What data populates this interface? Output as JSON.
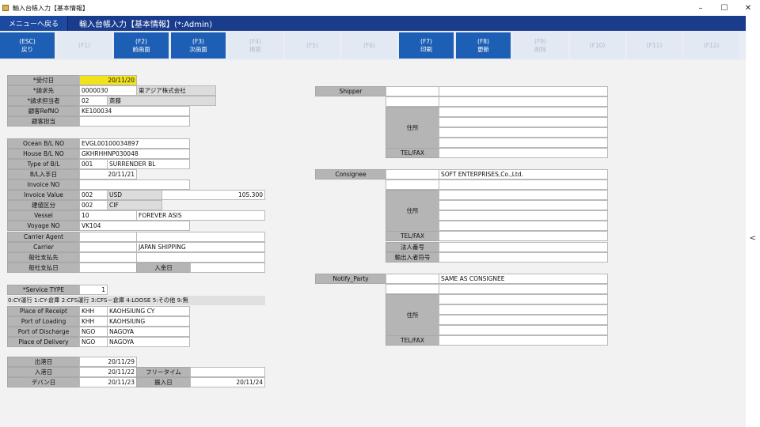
{
  "window": {
    "title": "輸入台帳入力【基本情報】",
    "min": "–",
    "max": "☐",
    "close": "✕"
  },
  "header": {
    "back": "メニューへ戻る",
    "title": "輸入台帳入力【基本情報】(*:Admin)"
  },
  "fkeys": [
    {
      "k": "(ESC)",
      "l": "戻り",
      "on": true
    },
    {
      "k": "(F1)",
      "l": "",
      "on": false
    },
    {
      "k": "(F2)",
      "l": "前画面",
      "on": true
    },
    {
      "k": "(F3)",
      "l": "次画面",
      "on": true
    },
    {
      "k": "(F4)",
      "l": "検索",
      "on": false
    },
    {
      "k": "(F5)",
      "l": "",
      "on": false
    },
    {
      "k": "(F6)",
      "l": "",
      "on": false
    },
    {
      "k": "(F7)",
      "l": "印刷",
      "on": true
    },
    {
      "k": "(F8)",
      "l": "更新",
      "on": true
    },
    {
      "k": "(F9)",
      "l": "削除",
      "on": false
    },
    {
      "k": "(F10)",
      "l": "",
      "on": false
    },
    {
      "k": "(F11)",
      "l": "",
      "on": false
    },
    {
      "k": "(F12)",
      "l": "",
      "on": false
    }
  ],
  "left": {
    "receipt_date_label": "*受付日",
    "receipt_date": "20/11/20",
    "bill_to_label": "*請求先",
    "bill_to_code": "0000030",
    "bill_to_name": "東アジア株式会社",
    "invoice_person_label": "*請求担当者",
    "invoice_person_code": "02",
    "invoice_person_name": "斎藤",
    "customer_ref_label": "顧客RefNO",
    "customer_ref": "KE100034",
    "customer_person_label": "顧客担当",
    "ocean_bl_label": "Ocean B/L NO",
    "ocean_bl": "EVGL00100034897",
    "house_bl_label": "House B/L NO",
    "house_bl": "GKHRHHNP030048",
    "bl_type_label": "Type of B/L",
    "bl_type_code": "001",
    "bl_type_name": "SURRENDER BL",
    "bl_received_label": "B/L入手日",
    "bl_received": "20/11/21",
    "invoice_no_label": "Invoice NO",
    "invoice_value_label": "Invoice  Value",
    "invoice_currency_code": "002",
    "invoice_currency": "USD",
    "invoice_value": "105.300",
    "incoterm_label": "建値区分",
    "incoterm_code": "002",
    "incoterm": "CIF",
    "vessel_label": "Vessel",
    "vessel_code": "10",
    "vessel_name": "FOREVER ASIS",
    "voyage_label": "Voyage NO",
    "voyage": "VK104",
    "carrier_agent_label": "Carrier Agent",
    "carrier_label": "Carrier",
    "carrier_name": "JAPAN SHIPPING",
    "shipco_payee_label": "船社支払先",
    "shipco_paydate_label": "船社支払日",
    "deposit_date_label": "入金日",
    "service_type_label": "*Service  TYPE",
    "service_type": "1",
    "service_legend": "0:CY運行 1:CY-倉庫 2:CFS運行 3:CFS－倉庫 4:LOOSE 5:その他 9:無",
    "por_label": "Place of Receipt",
    "por_code": "KHH",
    "por_name": "KAOHSIUNG CY",
    "pol_label": "Port of Loading",
    "pol_code": "KHH",
    "pol_name": "KAOHSIUNG",
    "pod_label": "Port of Discharge",
    "pod_code": "NGO",
    "pod_name": "NAGOYA",
    "pdl_label": "Place of Delivery",
    "pdl_code": "NGO",
    "pdl_name": "NAGOYA",
    "departure_label": "出港日",
    "departure": "20/11/29",
    "arrival_label": "入港日",
    "arrival": "20/11/22",
    "freetime_label": "フリータイム",
    "devan_label": "デバン日",
    "devan": "20/11/23",
    "bonded_in_label": "搬入日",
    "bonded_in": "20/11/24"
  },
  "right": {
    "shipper_label": "Shipper",
    "address_label": "住所",
    "telfax_label": "TEL/FAX",
    "consignee_label": "Consignee",
    "consignee_name": "SOFT ENTERPRISES,Co.,Ltd.",
    "corp_no_label": "法人番号",
    "importer_code_label": "輸出入者符号",
    "notify_label": "Notify_Party",
    "notify_name": "SAME AS CONSIGNEE"
  }
}
